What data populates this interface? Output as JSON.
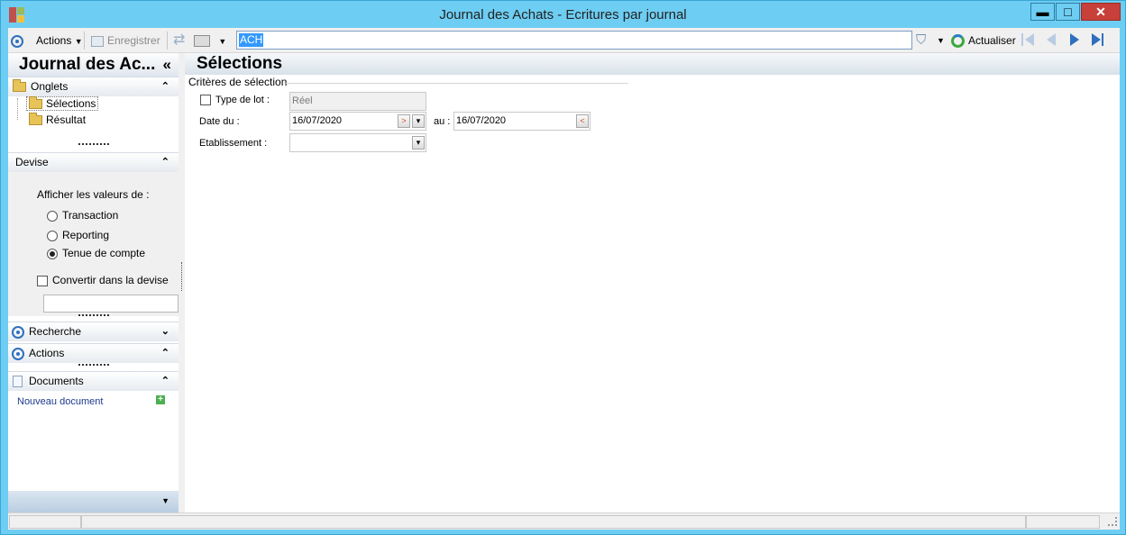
{
  "window": {
    "title": "Journal des Achats -  Ecritures par journal",
    "minimize": "▬",
    "maximize": "□",
    "close": "✕"
  },
  "toolbar": {
    "actions_label": "Actions",
    "save_label": "Enregistrer",
    "search_value": "ACH",
    "refresh_label": "Actualiser"
  },
  "leftpane": {
    "title": "Journal des Ac...",
    "collapse_glyph": "«",
    "onglets": {
      "label": "Onglets",
      "items": [
        "Sélections",
        "Résultat"
      ]
    },
    "devise": {
      "label": "Devise",
      "prompt": "Afficher les valeurs de :",
      "options": [
        "Transaction",
        "Reporting",
        "Tenue de compte"
      ],
      "selected": "Tenue de compte",
      "convert_label": "Convertir dans la devise",
      "convert_checked": false
    },
    "recherche": {
      "label": "Recherche"
    },
    "actions": {
      "label": "Actions"
    },
    "documents": {
      "label": "Documents",
      "new_doc": "Nouveau document"
    }
  },
  "main": {
    "title": "Sélections",
    "criteria_label": "Critères de sélection",
    "type_lot_label": "Type de lot :",
    "type_lot_checked": false,
    "type_lot_value": "Réel",
    "date_du_label": "Date du :",
    "date_du_value": "16/07/2020",
    "au_label": "au :",
    "date_au_value": "16/07/2020",
    "etablissement_label": "Etablissement :",
    "etablissement_value": ""
  },
  "colors": {
    "window_frame": "#6ecdf2",
    "accent": "#2f6fbf",
    "close_button": "#c7403a"
  }
}
